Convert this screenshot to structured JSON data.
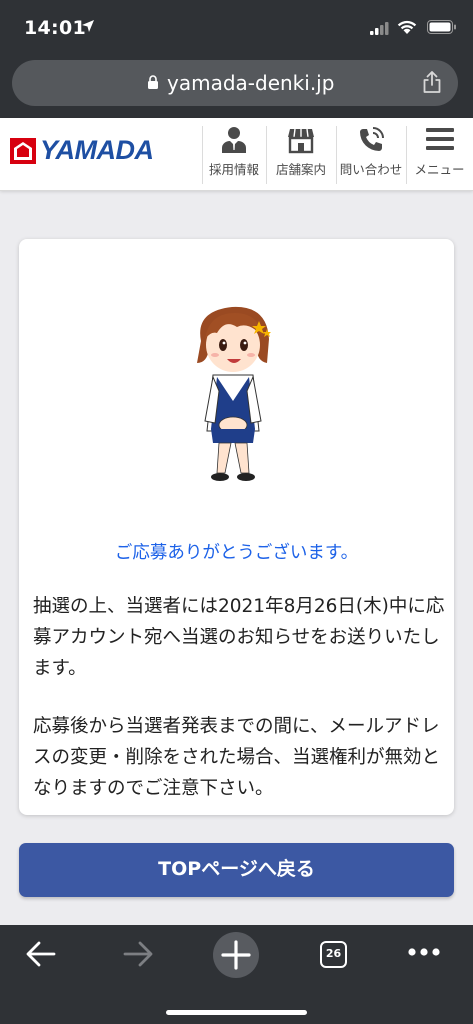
{
  "status_bar": {
    "time": "14:01"
  },
  "browser": {
    "url": "yamada-denki.jp",
    "tab_count": "26"
  },
  "site_header": {
    "logo_text": "YAMADA",
    "nav": [
      {
        "label": "採用情報",
        "icon": "person-icon"
      },
      {
        "label": "店舗案内",
        "icon": "store-icon"
      },
      {
        "label": "問い合わせ",
        "icon": "phone-icon"
      },
      {
        "label": "メニュー",
        "icon": "menu-icon"
      }
    ]
  },
  "content": {
    "thanks": "ご応募ありがとうございます。",
    "paragraph1": "抽選の上、当選者には2021年8月26日(木)中に応募アカウント宛へ当選のお知らせをお送りいたします。",
    "paragraph2": "応募後から当選者発表までの間に、メールアドレスの変更・削除をされた場合、当選権利が無効となりますのでご注意下さい。"
  },
  "top_button": {
    "label": "TOPページへ戻る"
  },
  "colors": {
    "brand_blue": "#1e4fa3",
    "button_blue": "#3c58a3",
    "link_blue": "#1d62e8",
    "logo_red": "#d7000f"
  }
}
